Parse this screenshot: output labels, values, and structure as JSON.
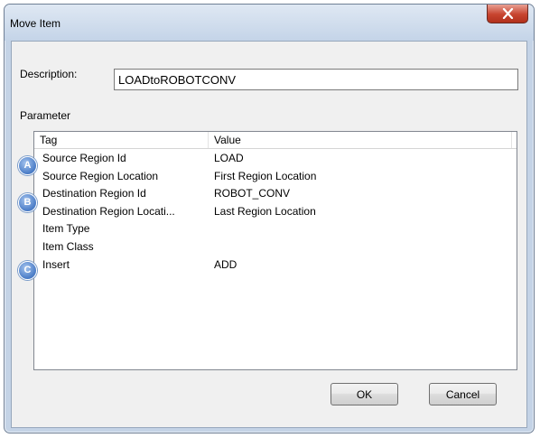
{
  "window": {
    "title": "Move Item"
  },
  "form": {
    "description_label": "Description:",
    "description_value": "LOADtoROBOTCONV",
    "parameter_label": "Parameter"
  },
  "list": {
    "columns": [
      "Tag",
      "Value"
    ],
    "rows": [
      {
        "tag": "Source Region Id",
        "value": "LOAD"
      },
      {
        "tag": "Source Region Location",
        "value": "First Region Location"
      },
      {
        "tag": "Destination Region Id",
        "value": "ROBOT_CONV"
      },
      {
        "tag": "Destination Region Locati...",
        "value": "Last Region Location"
      },
      {
        "tag": "Item Type",
        "value": ""
      },
      {
        "tag": "Item Class",
        "value": ""
      },
      {
        "tag": "Insert",
        "value": "ADD"
      }
    ]
  },
  "markers": [
    "A",
    "B",
    "C"
  ],
  "buttons": {
    "ok": "OK",
    "cancel": "Cancel"
  },
  "colors": {
    "marker_blue": "#4f80c9",
    "close_red": "#c7442f"
  }
}
